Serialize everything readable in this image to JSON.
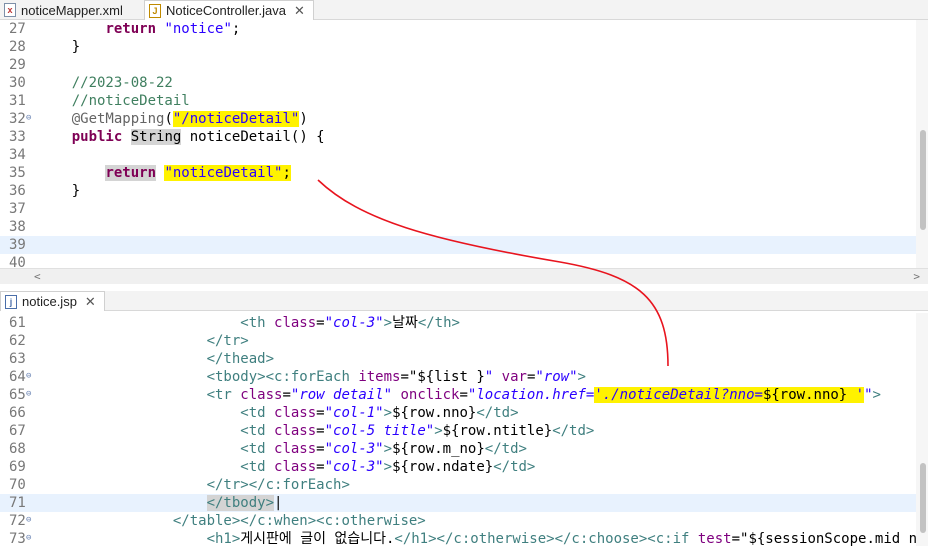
{
  "top_tabs": [
    {
      "label": "noticeMapper.xml",
      "icon": "xml-file-icon",
      "glyph": "x"
    },
    {
      "label": "NoticeController.java",
      "icon": "java-file-icon",
      "glyph": "J"
    }
  ],
  "top_editor": {
    "lines": [
      {
        "n": "27",
        "code": [
          {
            "t": "        "
          },
          {
            "t": "return",
            "c": "kw"
          },
          {
            "t": " "
          },
          {
            "t": "\"notice\"",
            "c": "str"
          },
          {
            "t": ";"
          }
        ]
      },
      {
        "n": "28",
        "code": [
          {
            "t": "    }"
          }
        ]
      },
      {
        "n": "29",
        "code": []
      },
      {
        "n": "30",
        "code": [
          {
            "t": "    "
          },
          {
            "t": "//2023-08-22",
            "c": "cmt"
          }
        ]
      },
      {
        "n": "31",
        "code": [
          {
            "t": "    "
          },
          {
            "t": "//noticeDetail",
            "c": "cmt"
          }
        ]
      },
      {
        "n": "32",
        "fold": true,
        "code": [
          {
            "t": "    "
          },
          {
            "t": "@GetMapping",
            "c": "ann"
          },
          {
            "t": "("
          },
          {
            "t": "\"/noticeDetail\"",
            "c": "str hl"
          },
          {
            "t": ")"
          }
        ]
      },
      {
        "n": "33",
        "code": [
          {
            "t": "    "
          },
          {
            "t": "public",
            "c": "kw"
          },
          {
            "t": " "
          },
          {
            "t": "String",
            "c": "occ"
          },
          {
            "t": " noticeDetail() {"
          }
        ]
      },
      {
        "n": "34",
        "code": []
      },
      {
        "n": "35",
        "code": [
          {
            "t": "        "
          },
          {
            "t": "return",
            "c": "kw occ"
          },
          {
            "t": " "
          },
          {
            "t": "\"noticeDetail\"",
            "c": "str hl"
          },
          {
            "t": ";",
            "c": "hl"
          }
        ]
      },
      {
        "n": "36",
        "code": [
          {
            "t": "    }"
          }
        ]
      },
      {
        "n": "37",
        "code": []
      },
      {
        "n": "38",
        "code": []
      },
      {
        "n": "39",
        "cur": true,
        "code": []
      },
      {
        "n": "40",
        "code": []
      }
    ]
  },
  "bottom_tabs": [
    {
      "label": "notice.jsp",
      "icon": "jsp-file-icon",
      "glyph": "j"
    }
  ],
  "bottom_editor": {
    "lines": [
      {
        "n": "61",
        "code": [
          {
            "t": "                        "
          },
          {
            "t": "<th ",
            "c": "tag"
          },
          {
            "t": "class",
            "c": "attr"
          },
          {
            "t": "="
          },
          {
            "t": "\"col-3\"",
            "c": "aval"
          },
          {
            "t": ">",
            "c": "tag"
          },
          {
            "t": "날짜"
          },
          {
            "t": "</th>",
            "c": "tag"
          }
        ]
      },
      {
        "n": "62",
        "code": [
          {
            "t": "                    "
          },
          {
            "t": "</tr>",
            "c": "tag"
          }
        ]
      },
      {
        "n": "63",
        "code": [
          {
            "t": "                    "
          },
          {
            "t": "</thead>",
            "c": "tag"
          }
        ]
      },
      {
        "n": "64",
        "fold": true,
        "code": [
          {
            "t": "                    "
          },
          {
            "t": "<tbody>",
            "c": "tag"
          },
          {
            "t": "<c:forEach ",
            "c": "tag"
          },
          {
            "t": "items",
            "c": "attr"
          },
          {
            "t": "="
          },
          {
            "t": "\""
          },
          {
            "t": "${list }"
          },
          {
            "t": "\" ",
            "c": "aval"
          },
          {
            "t": "var",
            "c": "attr"
          },
          {
            "t": "="
          },
          {
            "t": "\"row\"",
            "c": "aval"
          },
          {
            "t": ">",
            "c": "tag"
          }
        ]
      },
      {
        "n": "65",
        "fold": true,
        "code": [
          {
            "t": "                    "
          },
          {
            "t": "<tr ",
            "c": "tag"
          },
          {
            "t": "class",
            "c": "attr"
          },
          {
            "t": "="
          },
          {
            "t": "\"row detail\" ",
            "c": "aval"
          },
          {
            "t": "onclick",
            "c": "attr"
          },
          {
            "t": "="
          },
          {
            "t": "\"location.href=",
            "c": "aval"
          },
          {
            "t": "'./noticeDetail?nno=",
            "c": "aval hl"
          },
          {
            "t": "${row.nno}",
            "c": "hl"
          },
          {
            "t": " '",
            "c": "aval hl"
          },
          {
            "t": "\"",
            "c": "aval"
          },
          {
            "t": ">",
            "c": "tag"
          }
        ]
      },
      {
        "n": "66",
        "code": [
          {
            "t": "                        "
          },
          {
            "t": "<td ",
            "c": "tag"
          },
          {
            "t": "class",
            "c": "attr"
          },
          {
            "t": "="
          },
          {
            "t": "\"col-1\"",
            "c": "aval"
          },
          {
            "t": ">",
            "c": "tag"
          },
          {
            "t": "${row.nno}"
          },
          {
            "t": "</td>",
            "c": "tag"
          }
        ]
      },
      {
        "n": "67",
        "code": [
          {
            "t": "                        "
          },
          {
            "t": "<td ",
            "c": "tag"
          },
          {
            "t": "class",
            "c": "attr"
          },
          {
            "t": "="
          },
          {
            "t": "\"col-5 title\"",
            "c": "aval"
          },
          {
            "t": ">",
            "c": "tag"
          },
          {
            "t": "${row.ntitle}"
          },
          {
            "t": "</td>",
            "c": "tag"
          }
        ]
      },
      {
        "n": "68",
        "code": [
          {
            "t": "                        "
          },
          {
            "t": "<td ",
            "c": "tag"
          },
          {
            "t": "class",
            "c": "attr"
          },
          {
            "t": "="
          },
          {
            "t": "\"col-3\"",
            "c": "aval"
          },
          {
            "t": ">",
            "c": "tag"
          },
          {
            "t": "${row.m_no}"
          },
          {
            "t": "</td>",
            "c": "tag"
          }
        ]
      },
      {
        "n": "69",
        "code": [
          {
            "t": "                        "
          },
          {
            "t": "<td ",
            "c": "tag"
          },
          {
            "t": "class",
            "c": "attr"
          },
          {
            "t": "="
          },
          {
            "t": "\"col-3\"",
            "c": "aval"
          },
          {
            "t": ">",
            "c": "tag"
          },
          {
            "t": "${row.ndate}"
          },
          {
            "t": "</td>",
            "c": "tag"
          }
        ]
      },
      {
        "n": "70",
        "code": [
          {
            "t": "                    "
          },
          {
            "t": "</tr>",
            "c": "tag"
          },
          {
            "t": "</c:forEach>",
            "c": "tag"
          }
        ]
      },
      {
        "n": "71",
        "cur": true,
        "code": [
          {
            "t": "                    "
          },
          {
            "t": "</tbody>",
            "c": "tag occ"
          },
          {
            "t": "|"
          }
        ]
      },
      {
        "n": "72",
        "fold": true,
        "code": [
          {
            "t": "                "
          },
          {
            "t": "</table>",
            "c": "tag"
          },
          {
            "t": "</c:when>",
            "c": "tag"
          },
          {
            "t": "<c:otherwise>",
            "c": "tag"
          }
        ]
      },
      {
        "n": "73",
        "fold": true,
        "code": [
          {
            "t": "                    "
          },
          {
            "t": "<h1>",
            "c": "tag"
          },
          {
            "t": "게시판에 글이 없습니다."
          },
          {
            "t": "</h1>",
            "c": "tag"
          },
          {
            "t": "</c:otherwise>",
            "c": "tag"
          },
          {
            "t": "</c:choose>",
            "c": "tag"
          },
          {
            "t": "<c:if ",
            "c": "tag"
          },
          {
            "t": "test",
            "c": "attr"
          },
          {
            "t": "="
          },
          {
            "t": "\""
          },
          {
            "t": "${sessionScope.mid ne"
          }
        ]
      }
    ]
  },
  "icons": {
    "close": "close-icon",
    "scroll_left": "scroll-left-arrow-icon",
    "scroll_right": "scroll-right-arrow-icon"
  },
  "colors": {
    "keyword": "#7f0055",
    "string": "#2a00ff",
    "comment": "#3f7f5f",
    "tag": "#3f7f7f",
    "attribute": "#7f007f",
    "highlight": "#fff200",
    "annotation_arrow": "#e8141e"
  }
}
